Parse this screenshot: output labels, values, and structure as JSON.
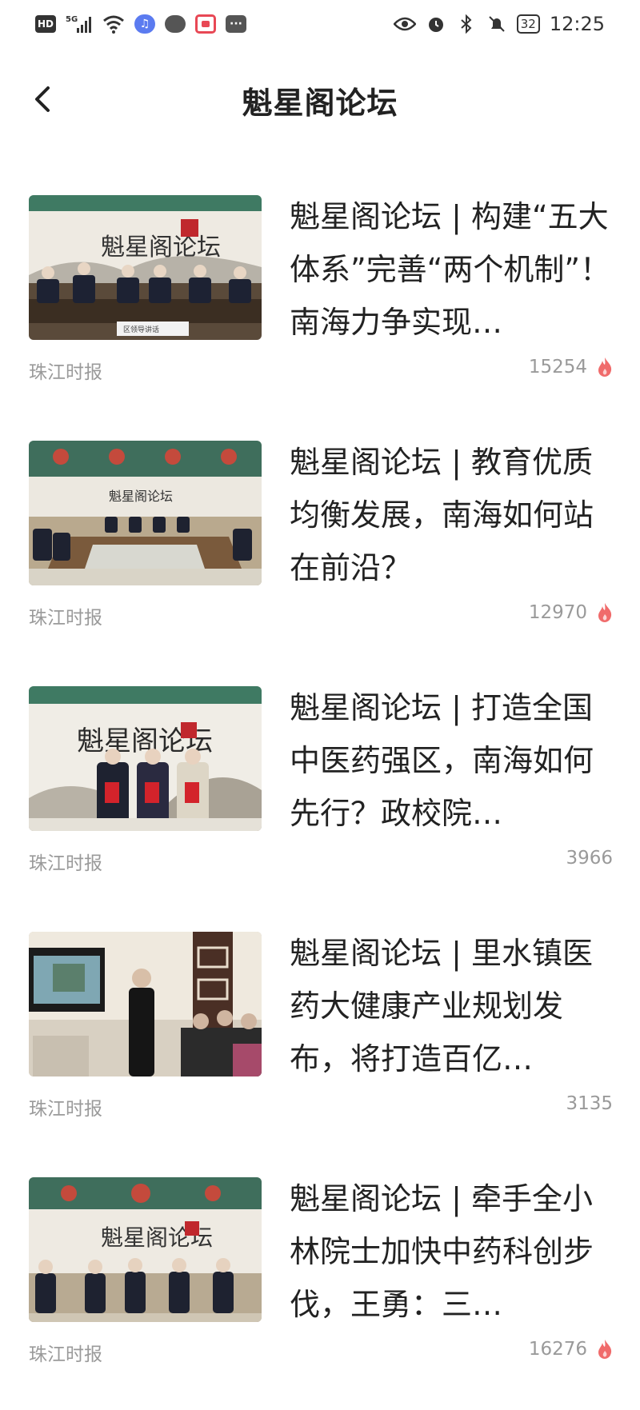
{
  "status_bar": {
    "left_badges": [
      "HD",
      "5G"
    ],
    "battery": "32",
    "time": "12:25"
  },
  "nav": {
    "title": "魁星阁论坛"
  },
  "articles": [
    {
      "headline": "魁星阁论坛 | 构建“五大体系”完善“两个机制”！南海力争实现…",
      "source": "珠江时报",
      "count": "15254",
      "hot": true,
      "thumb_banner": "魁星阁论坛",
      "thumb_sign": "区领导讲话"
    },
    {
      "headline": "魁星阁论坛 | 教育优质均衡发展，南海如何站在前沿？",
      "source": "珠江时报",
      "count": "12970",
      "hot": true,
      "thumb_banner": "魁星阁论坛",
      "thumb_sign": ""
    },
    {
      "headline": "魁星阁论坛 | 打造全国中医药强区，南海如何先行？政校院…",
      "source": "珠江时报",
      "count": "3966",
      "hot": false,
      "thumb_banner": "魁星阁论坛",
      "thumb_sign": ""
    },
    {
      "headline": "魁星阁论坛 | 里水镇医药大健康产业规划发布，将打造百亿…",
      "source": "珠江时报",
      "count": "3135",
      "hot": false,
      "thumb_banner": "",
      "thumb_sign": ""
    },
    {
      "headline": "魁星阁论坛 | 牵手全小林院士加快中药科创步伐，王勇：三…",
      "source": "珠江时报",
      "count": "16276",
      "hot": true,
      "thumb_banner": "魁星阁论坛",
      "thumb_sign": ""
    }
  ],
  "colors": {
    "hot_flame": "#f06b6b",
    "meta_text": "#9a9a9a",
    "headline_text": "#222222"
  }
}
